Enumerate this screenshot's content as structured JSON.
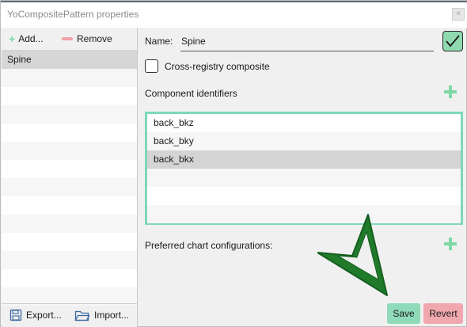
{
  "window": {
    "title": "YoCompositePattern properties",
    "close_glyph": "×"
  },
  "left_toolbar": {
    "add_label": "Add...",
    "remove_label": "Remove"
  },
  "patterns": {
    "items": [
      "Spine",
      "",
      "",
      "",
      "",
      "",
      "",
      "",
      "",
      "",
      "",
      "",
      "",
      ""
    ],
    "selected": "Spine"
  },
  "bottom_bar": {
    "export_label": "Export...",
    "import_label": "Import..."
  },
  "form": {
    "name_label": "Name:",
    "name_value": "Spine",
    "cross_registry_label": "Cross-registry composite",
    "component_ids_label": "Component identifiers",
    "component_ids": [
      "back_bkz",
      "back_bky",
      "back_bkx",
      "",
      "",
      ""
    ],
    "selected_component": "back_bkx",
    "preferred_chart_label": "Preferred chart configurations:"
  },
  "actions": {
    "save_label": "Save",
    "revert_label": "Revert"
  },
  "colors": {
    "accent_green": "#7ed8b8",
    "save_bg": "#8fdab8",
    "revert_bg": "#f0a8ae",
    "arrow": "#1f7a2a"
  },
  "icons": {
    "close": "close-icon",
    "add": "plus-icon",
    "remove": "minus-icon",
    "export": "floppy-disk-icon",
    "import": "folder-icon",
    "confirm": "checkmark-icon",
    "annotation": "arrow-pointer-icon"
  }
}
